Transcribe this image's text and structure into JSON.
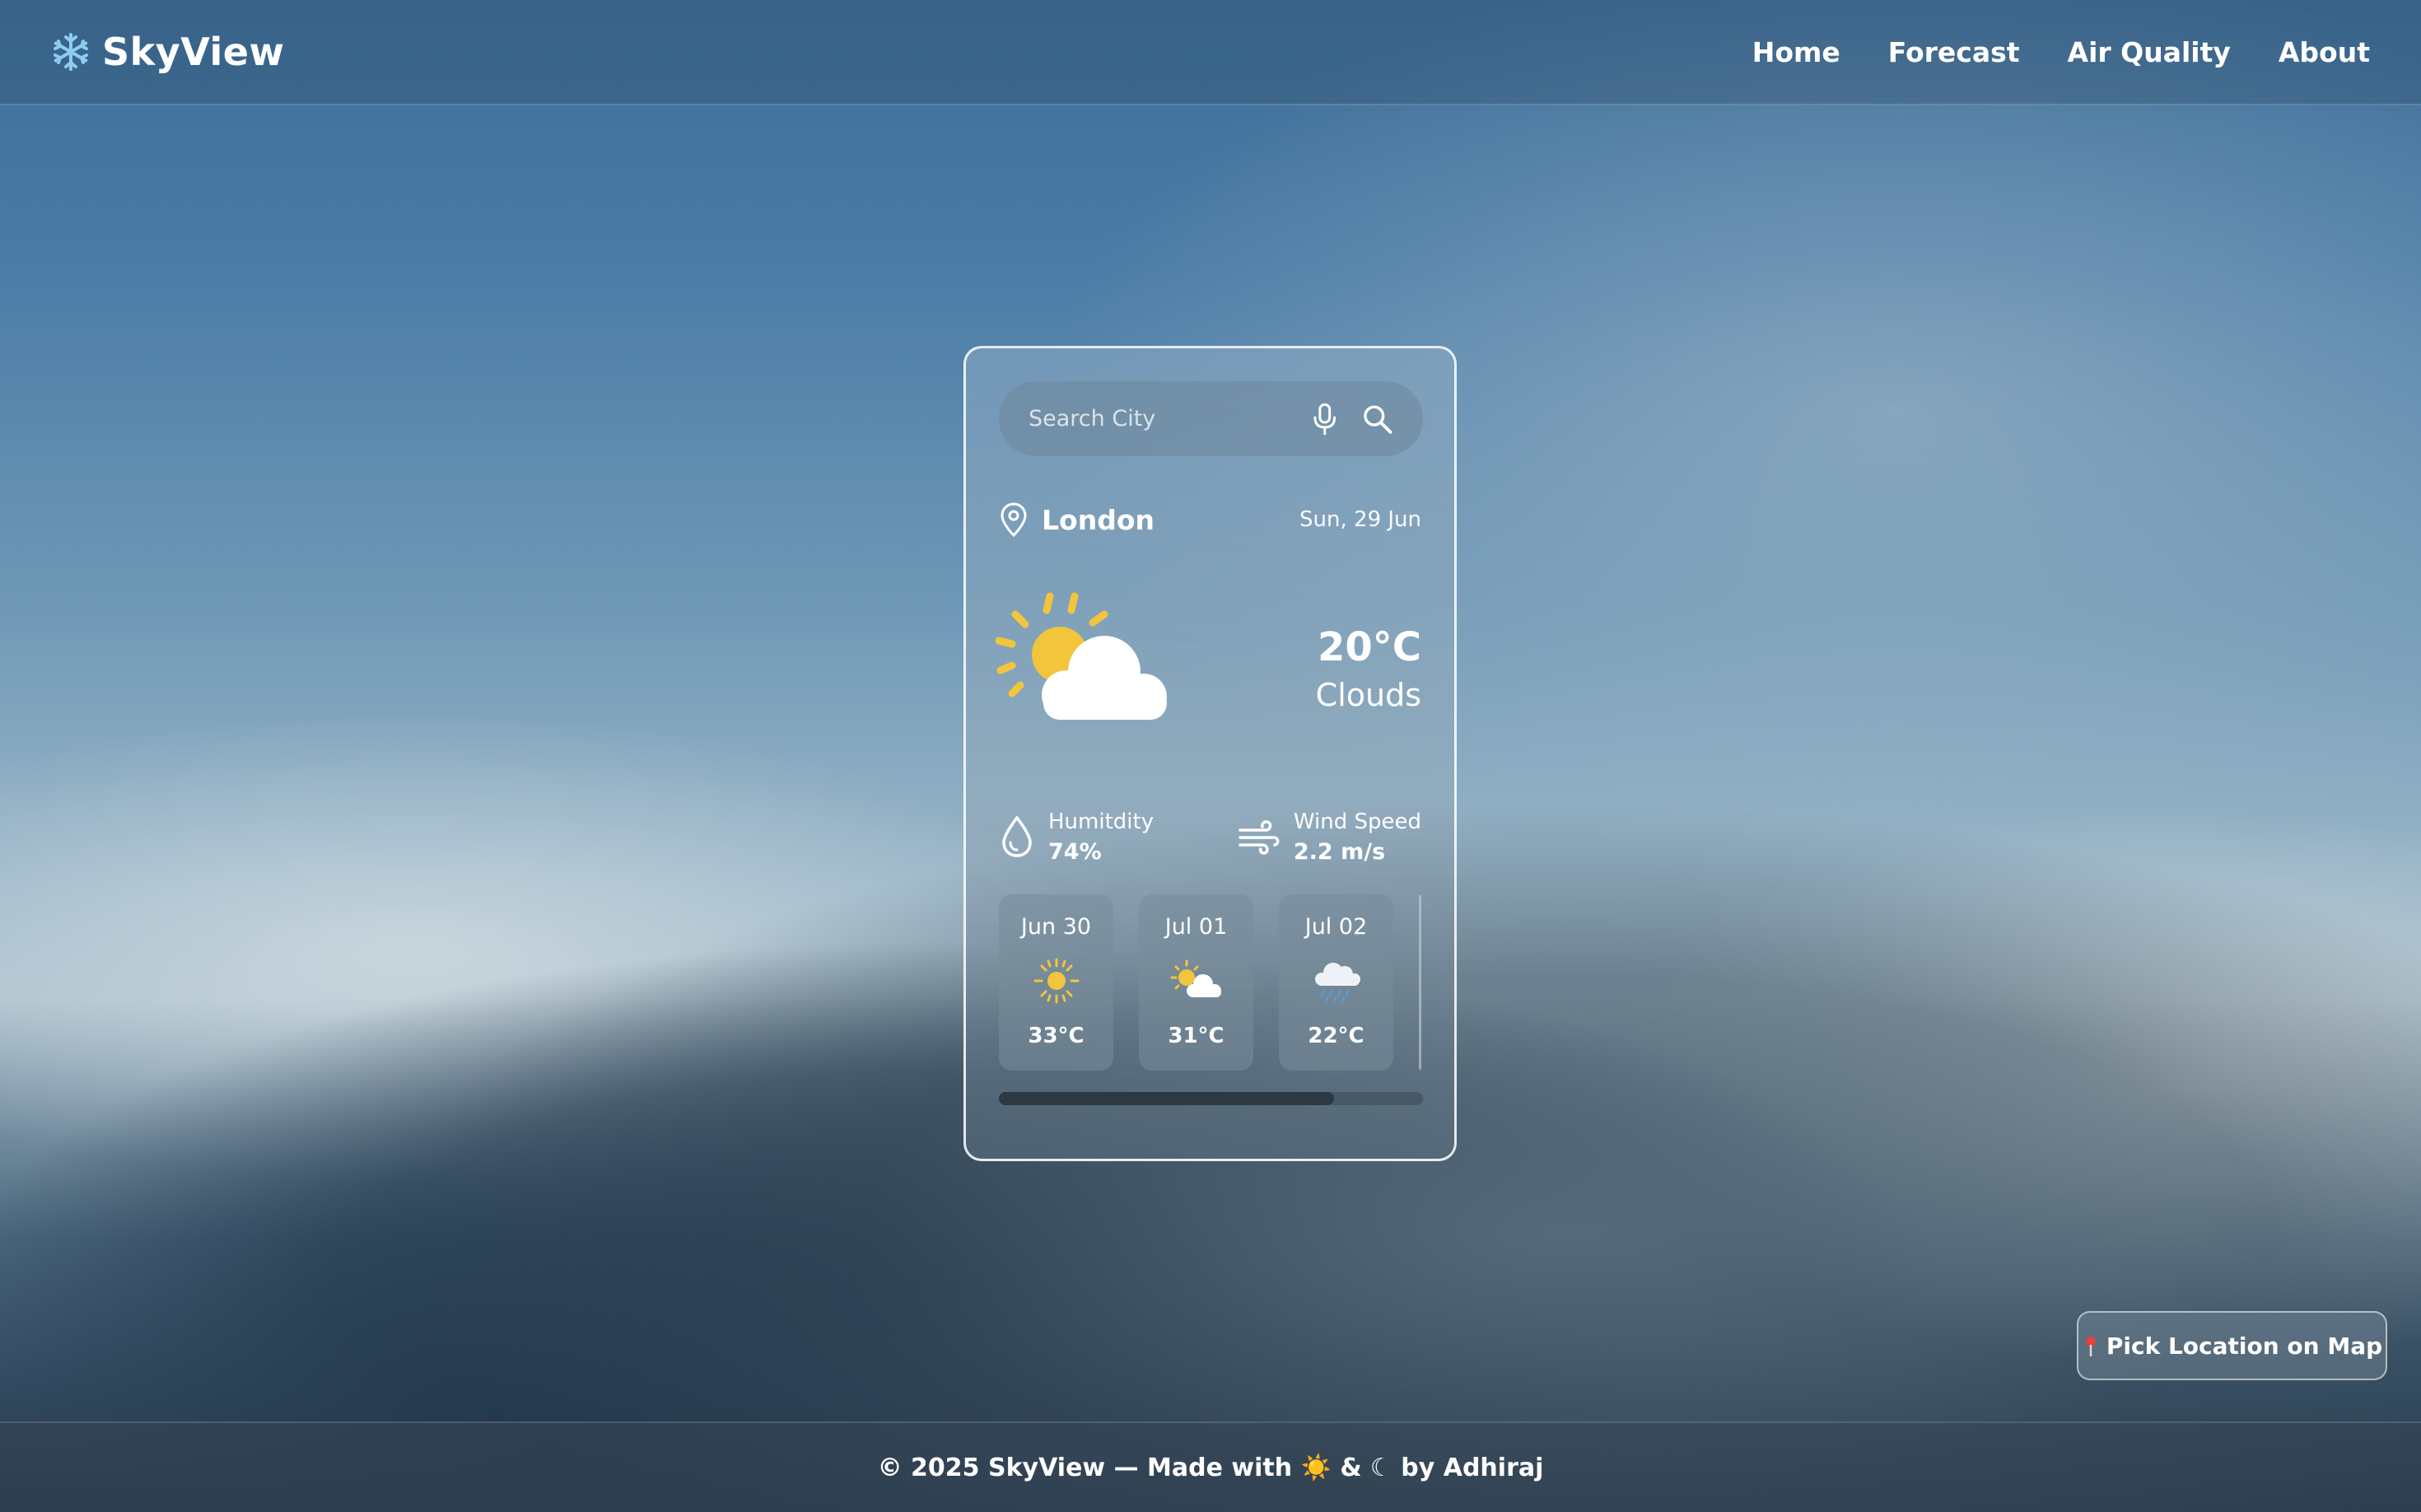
{
  "header": {
    "brand_icon": "snowflake-icon",
    "brand_name": "SkyView",
    "nav": [
      "Home",
      "Forecast",
      "Air Quality",
      "About"
    ]
  },
  "card": {
    "search": {
      "placeholder": "Search City",
      "mic_icon": "microphone-icon",
      "search_icon": "magnifier-icon"
    },
    "location": {
      "icon": "map-pin-icon",
      "city": "London",
      "date": "Sun, 29 Jun"
    },
    "current": {
      "icon": "sun-behind-cloud-icon",
      "temperature": "20°C",
      "condition": "Clouds"
    },
    "stats": {
      "humidity": {
        "icon": "droplet-icon",
        "label": "Humitdity",
        "value": "74%"
      },
      "wind": {
        "icon": "wind-icon",
        "label": "Wind Speed",
        "value": "2.2 m/s"
      }
    },
    "forecast": [
      {
        "date": "Jun 30",
        "icon": "sun-icon",
        "temp": "33°C"
      },
      {
        "date": "Jul 01",
        "icon": "sun-cloud-icon",
        "temp": "31°C"
      },
      {
        "date": "Jul 02",
        "icon": "rain-cloud-icon",
        "temp": "22°C"
      }
    ],
    "forecast_scroll_fraction": 0.79
  },
  "map_button": {
    "icon": "red-pin-icon",
    "label": "Pick Location on Map"
  },
  "footer": {
    "text": "© 2025 SkyView — Made with ☀️ & ☾ by Adhiraj"
  },
  "colors": {
    "sun": "#f2c53d",
    "cloud": "#ffffff",
    "accent_pin": "#e0453a"
  }
}
